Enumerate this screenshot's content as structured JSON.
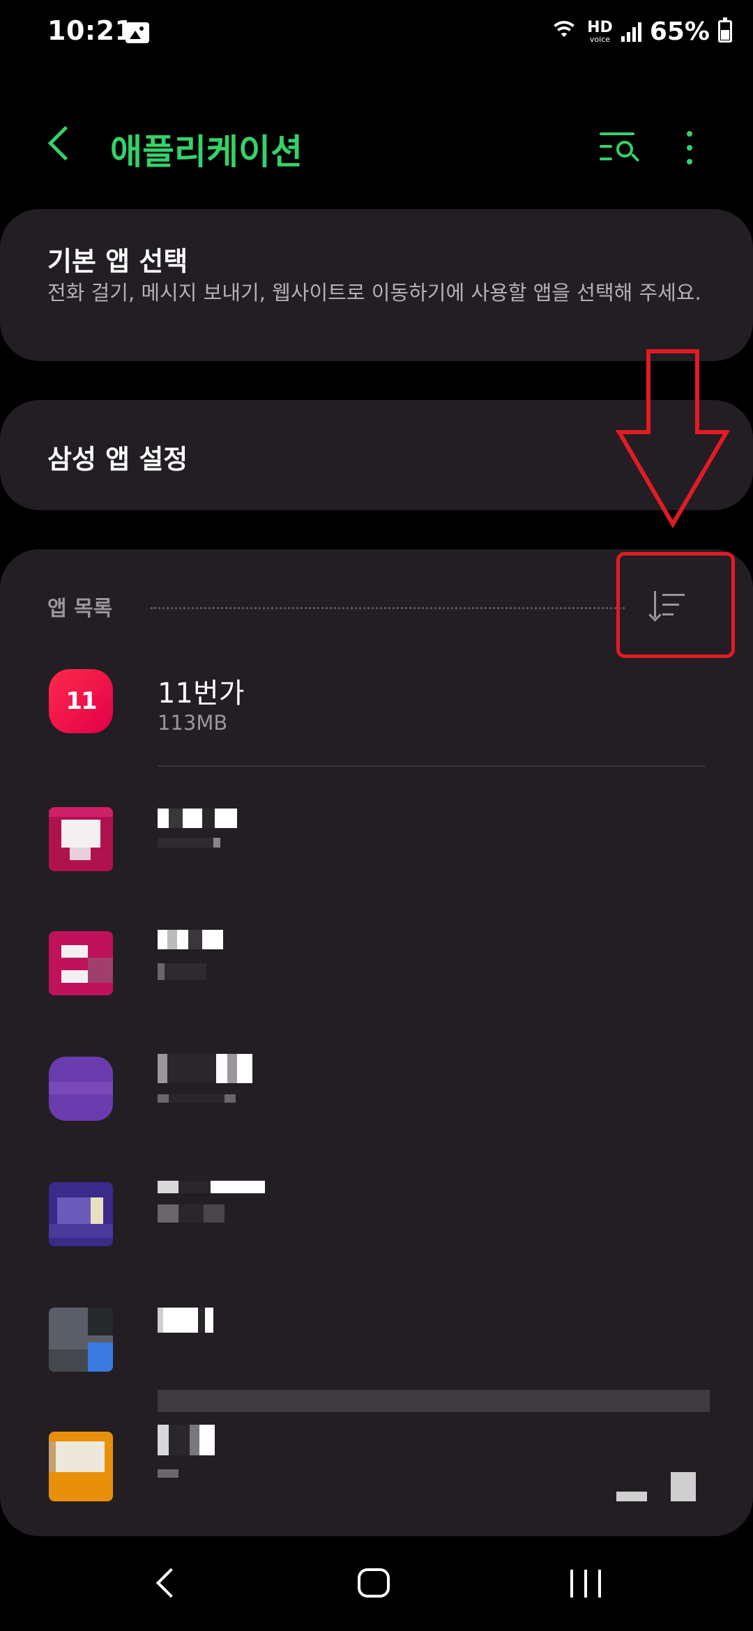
{
  "status_bar": {
    "time": "10:21",
    "hd": "HD",
    "voice": "voice",
    "battery": "65%"
  },
  "app_bar": {
    "title": "애플리케이션"
  },
  "default_apps": {
    "title": "기본 앱 선택",
    "subtitle": "전화 걸기, 메시지 보내기, 웹사이트로 이동하기에 사용할 앱을 선택해 주세요."
  },
  "samsung_apps": {
    "title": "삼성 앱 설정"
  },
  "app_list": {
    "header": "앱 목록",
    "items": [
      {
        "name": "11번가",
        "size": "113MB",
        "icon": "11st-icon",
        "icon_text": "11"
      }
    ]
  },
  "colors": {
    "accent": "#34d26a",
    "card": "#221e24",
    "annotation": "#e21b23"
  },
  "icons": [
    "back-icon",
    "search-filter-icon",
    "more-options-icon",
    "sort-icon",
    "image-icon",
    "wifi-icon",
    "signal-icon",
    "battery-icon",
    "nav-back-icon",
    "nav-home-icon",
    "nav-recents-icon"
  ]
}
